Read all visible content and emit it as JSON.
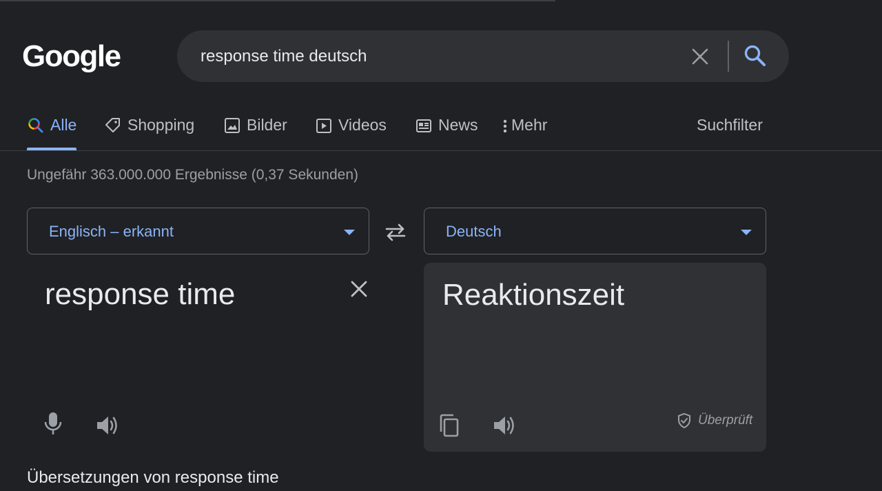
{
  "logo": "Google",
  "search": {
    "query": "response time deutsch"
  },
  "tabs": [
    {
      "label": "Alle",
      "icon": "search-multicolor-icon",
      "active": true
    },
    {
      "label": "Shopping",
      "icon": "tag-icon"
    },
    {
      "label": "Bilder",
      "icon": "image-icon"
    },
    {
      "label": "Videos",
      "icon": "play-icon"
    },
    {
      "label": "News",
      "icon": "newspaper-icon"
    },
    {
      "label": "Mehr",
      "icon": "more-vert-icon"
    }
  ],
  "tools_label": "Suchfilter",
  "result_stats": "Ungefähr 363.000.000 Ergebnisse (0,37 Sekunden)",
  "translate": {
    "source_lang": "Englisch – erkannt",
    "target_lang": "Deutsch",
    "source_text": "response time",
    "target_text": "Reaktionszeit",
    "verified_label": "Überprüft"
  },
  "translations_heading": "Übersetzungen von response time",
  "colors": {
    "accent": "#8ab4f8",
    "background": "#202124",
    "surface": "#303134"
  }
}
